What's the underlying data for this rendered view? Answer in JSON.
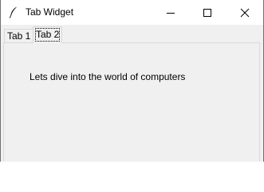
{
  "window": {
    "title": "Tab Widget",
    "icon": "feather-icon"
  },
  "controls": {
    "minimize_icon": "minimize-icon",
    "maximize_icon": "maximize-icon",
    "close_icon": "close-icon"
  },
  "tabs": [
    {
      "label": "Tab 1",
      "selected": false
    },
    {
      "label": "Tab 2",
      "selected": true
    }
  ],
  "panel": {
    "text": "Lets dive into the world of computers"
  },
  "colors": {
    "window_bg": "#f0f0f0",
    "titlebar_bg": "#ffffff",
    "tab_border": "#d9d9d9"
  }
}
